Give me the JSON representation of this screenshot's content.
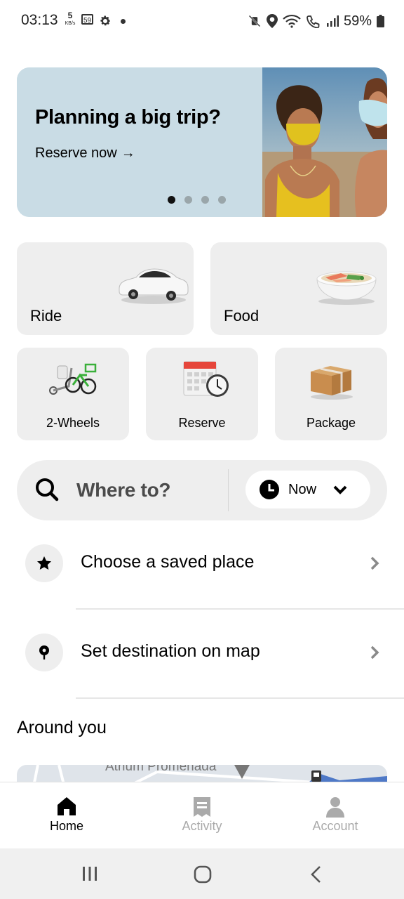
{
  "status_bar": {
    "time": "03:13",
    "net_speed_value": "5",
    "net_speed_unit": "KB/s",
    "badge": "59",
    "battery": "59%"
  },
  "promo": {
    "title": "Planning a big trip?",
    "link": "Reserve now",
    "link_arrow": "→",
    "pages": 4,
    "active_page": 1
  },
  "services": {
    "ride": "Ride",
    "food": "Food",
    "two_wheels": "2-Wheels",
    "reserve": "Reserve",
    "package": "Package"
  },
  "search": {
    "placeholder": "Where to?",
    "time_option": "Now"
  },
  "suggestions": [
    {
      "label": "Choose a saved place",
      "icon": "star-icon"
    },
    {
      "label": "Set destination on map",
      "icon": "map-pin-icon"
    }
  ],
  "around": {
    "title": "Around you",
    "map_label": "Atrium Promenada"
  },
  "bottom_nav": {
    "home": "Home",
    "activity": "Activity",
    "account": "Account",
    "active": "home"
  }
}
